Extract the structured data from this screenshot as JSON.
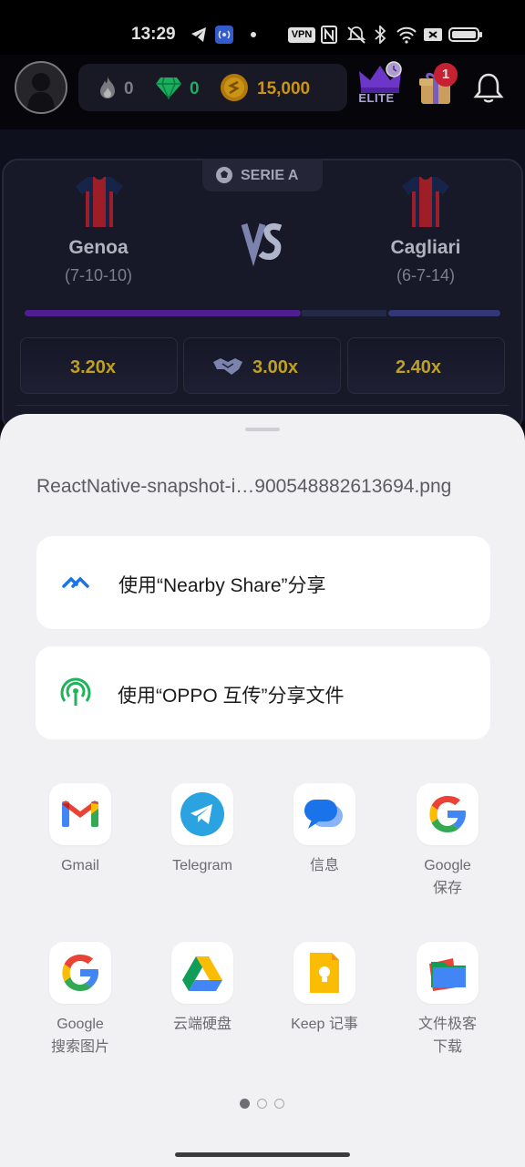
{
  "status_bar": {
    "time": "13:29",
    "vpn": "VPN"
  },
  "header": {
    "fire_count": "0",
    "gem_count": "0",
    "coin_count": "15,000",
    "elite_label": "ELITE",
    "gift_badge": "1",
    "colors": {
      "gem": "#1ec76b",
      "coin": "#e6a817",
      "badge": "#e2263a"
    }
  },
  "match": {
    "league": "SERIE A",
    "home": {
      "name": "Genoa",
      "record": "(7-10-10)"
    },
    "away": {
      "name": "Cagliari",
      "record": "(6-7-14)"
    },
    "probability": {
      "home": 0.58,
      "draw": 0.18,
      "away": 0.24
    },
    "odds": {
      "home": "3.20x",
      "draw": "3.00x",
      "away": "2.40x"
    },
    "colors": {
      "home_bar": "#5a23a8",
      "draw_bar": "#2b2f52",
      "away_bar": "#3a3f86",
      "odds_text": "#d9b82a"
    }
  },
  "share_sheet": {
    "filename": "ReactNative-snapshot-i…900548882613694.png",
    "nearby_share": "使用“Nearby Share”分享",
    "oppo_share": "使用“OPPO 互传”分享文件",
    "apps": [
      {
        "line1": "Gmail",
        "line2": "",
        "icon": "gmail-icon"
      },
      {
        "line1": "Telegram",
        "line2": "",
        "icon": "telegram-icon"
      },
      {
        "line1": "信息",
        "line2": "",
        "icon": "messages-icon"
      },
      {
        "line1": "Google",
        "line2": "保存",
        "icon": "google-icon"
      },
      {
        "line1": "Google",
        "line2": "搜索图片",
        "icon": "google-lens-icon"
      },
      {
        "line1": "云端硬盘",
        "line2": "",
        "icon": "google-drive-icon"
      },
      {
        "line1": "Keep 记事",
        "line2": "",
        "icon": "google-keep-icon"
      },
      {
        "line1": "文件极客",
        "line2": "下载",
        "icon": "files-icon"
      }
    ],
    "page_count": 3,
    "current_page": 1
  }
}
